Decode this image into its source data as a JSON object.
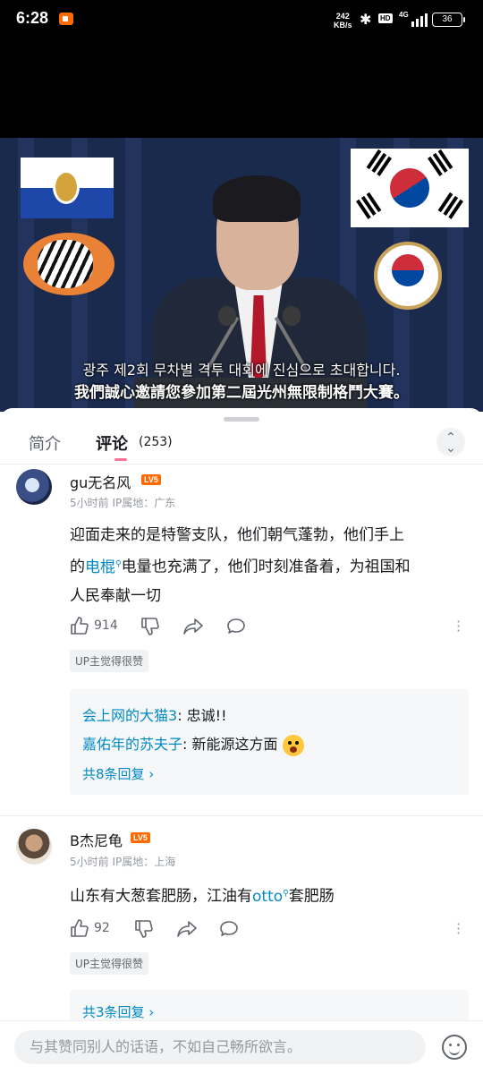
{
  "status_bar": {
    "time": "6:28",
    "net_speed_value": "242",
    "net_speed_unit": "KB/s",
    "bluetooth_icon": "bluetooth-icon",
    "hd_label": "HD",
    "network": "4G",
    "battery": "36"
  },
  "video": {
    "subtitle_korean": "광주 제2회 무차별 격투 대회에 진심으로 초대합니다.",
    "subtitle_chinese": "我們誠心邀請您參加第二屆光州無限制格鬥大賽。"
  },
  "tabs": {
    "intro": "简介",
    "comments": "评论",
    "comment_count": "(253)"
  },
  "comments": [
    {
      "username": "gu无名风",
      "level": "LV5",
      "meta": "5小时前 IP属地：广东",
      "text_line1": "迎面走来的是特警支队，他们朝气蓬勃，他们手上",
      "text_line2_pre": "的",
      "text_line2_link": "电棍",
      "text_line2_post": "电量也充满了，他们时刻准备着，为祖国和",
      "text_line3": "人民奉献一切",
      "likes": "914",
      "up_tag": "UP主觉得很赞",
      "replies": [
        {
          "user": "会上网的大猫3",
          "text": ": 忠诚!!"
        },
        {
          "user": "嘉佑年的苏夫子",
          "text": ": 新能源这方面"
        }
      ],
      "reply_more": "共8条回复 ›"
    },
    {
      "username": "B杰尼龟",
      "level": "LV5",
      "meta": "5小时前 IP属地：上海",
      "text_pre": "山东有大葱套肥肠，江油有",
      "text_link": "otto",
      "text_post": "套肥肠",
      "likes": "92",
      "up_tag": "UP主觉得很赞",
      "reply_more": "共3条回复 ›"
    }
  ],
  "input": {
    "placeholder": "与其赞同别人的话语，不如自己畅所欲言。"
  },
  "colors": {
    "accent_pink": "#fb7299",
    "link_blue": "#008ac5",
    "level_orange": "#ff6a00"
  }
}
